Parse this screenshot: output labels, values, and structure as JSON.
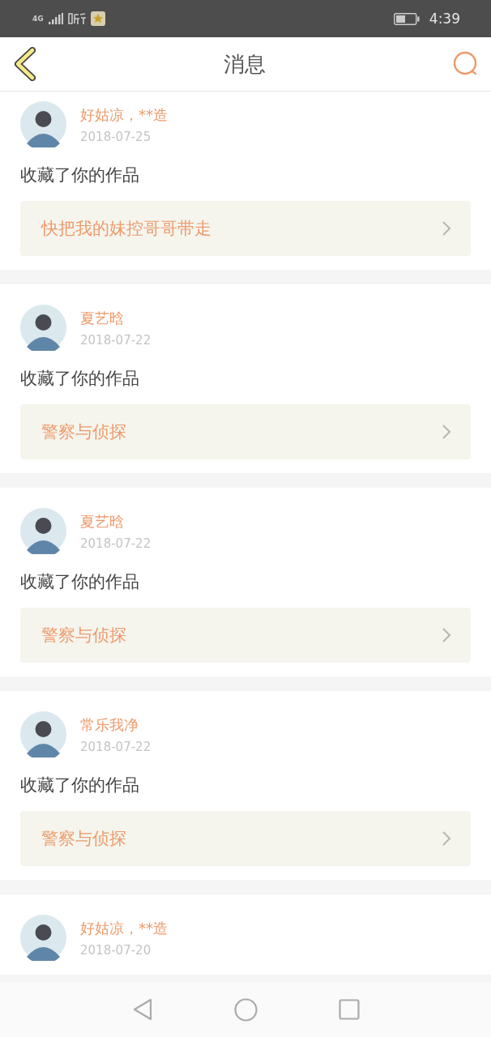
{
  "status_bar": {
    "network": "4G",
    "time": "4:39"
  },
  "header": {
    "title": "消息"
  },
  "messages": [
    {
      "user": "好姑凉，**造",
      "date": "2018-07-25",
      "action": "收藏了你的作品",
      "work": "快把我的妹控哥哥带走"
    },
    {
      "user": "夏艺晗",
      "date": "2018-07-22",
      "action": "收藏了你的作品",
      "work": "警察与侦探"
    },
    {
      "user": "夏艺晗",
      "date": "2018-07-22",
      "action": "收藏了你的作品",
      "work": "警察与侦探"
    },
    {
      "user": "常乐我净",
      "date": "2018-07-22",
      "action": "收藏了你的作品",
      "work": "警察与侦探"
    },
    {
      "user": "好姑凉，**造",
      "date": "2018-07-20"
    }
  ]
}
